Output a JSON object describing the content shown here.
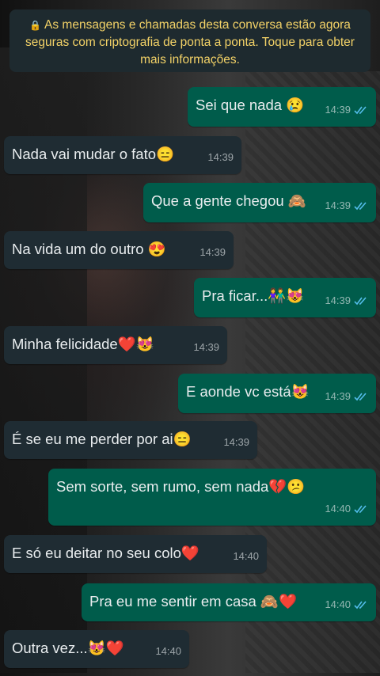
{
  "banner": {
    "icon": "lock-icon",
    "text": "As mensagens e chamadas desta conversa estão agora seguras com criptografia de ponta a ponta. Toque para obter mais informações."
  },
  "colors": {
    "incoming": "#1f2c33",
    "outgoing": "#005c4b",
    "banner_text": "#f3d267",
    "read_tick": "#53bdeb"
  },
  "messages": [
    {
      "dir": "out",
      "text": "Sei que nada 😢",
      "time": "14:39",
      "status": "read"
    },
    {
      "dir": "in",
      "text": "Nada vai mudar o fato😑",
      "time": "14:39"
    },
    {
      "dir": "out",
      "text": "Que a gente chegou 🙈",
      "time": "14:39",
      "status": "read"
    },
    {
      "dir": "in",
      "text": "Na vida um do outro 😍",
      "time": "14:39"
    },
    {
      "dir": "out",
      "text": "Pra ficar...👫😻",
      "time": "14:39",
      "status": "read"
    },
    {
      "dir": "in",
      "text": "Minha felicidade❤️😻",
      "time": "14:39"
    },
    {
      "dir": "out",
      "text": "E aonde vc está😻",
      "time": "14:39",
      "status": "read"
    },
    {
      "dir": "in",
      "text": "É se eu me perder por ai😑",
      "time": "14:39"
    },
    {
      "dir": "out",
      "text": "Sem sorte, sem rumo, sem nada💔😕",
      "time": "14:40",
      "status": "read"
    },
    {
      "dir": "in",
      "text": "E só eu deitar no seu colo❤️",
      "time": "14:40"
    },
    {
      "dir": "out",
      "text": "Pra eu me sentir em casa 🙈❤️",
      "time": "14:40",
      "status": "read"
    },
    {
      "dir": "in",
      "text": "Outra vez...😻❤️",
      "time": "14:40"
    }
  ]
}
